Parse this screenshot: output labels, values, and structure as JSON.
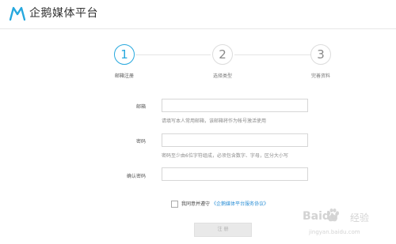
{
  "header": {
    "logo_text": "企鹅媒体平台"
  },
  "steps": [
    {
      "number": "1",
      "label": "邮箱注册"
    },
    {
      "number": "2",
      "label": "选择类型"
    },
    {
      "number": "3",
      "label": "完善资料"
    }
  ],
  "form": {
    "email": {
      "label": "邮箱",
      "value": "",
      "hint": "请填写本人常用邮箱，该邮箱将作为帐号激活使用"
    },
    "password": {
      "label": "密码",
      "value": "",
      "hint": "密码至少由6位字符组成，必须包含数字、字母，区分大小写"
    },
    "confirm_password": {
      "label": "确认密码",
      "value": ""
    }
  },
  "agreement": {
    "checked": false,
    "text": "我同意并遵守",
    "link_text": "《企鹅媒体平台服务协议》"
  },
  "submit": {
    "label": "注 册"
  },
  "watermark": {
    "brand": "Baidu",
    "brand_suffix": "经验",
    "url": "jingyan.baidu.com"
  },
  "colors": {
    "accent": "#26a8de",
    "link": "#2b8fd6",
    "disabled_button": "#e9e9e9"
  }
}
